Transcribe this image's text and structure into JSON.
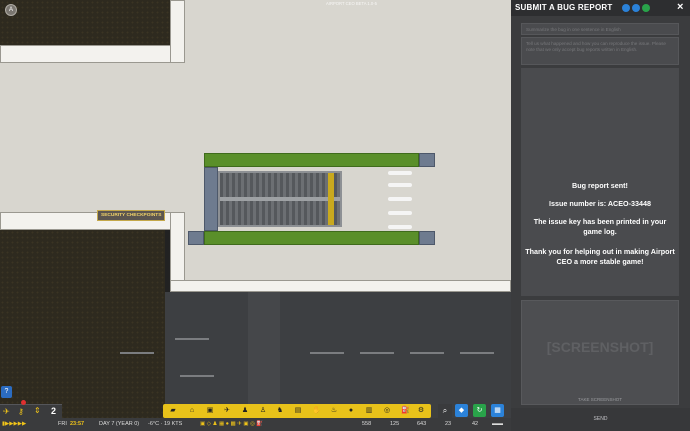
{
  "game": {
    "title": "Airport CEO",
    "build_version": "AIRPORT CEO BETA 1.0-5",
    "security_sign": "SECURITY CHECKPOINTS",
    "help_label": "?",
    "zoom_level": "2"
  },
  "bottom_bar": {
    "day_name": "FRI",
    "time": "23:57",
    "day_label": "DAY 7 (YEAR 0)",
    "weather": "-6°C · 19 KTS",
    "stat_1": "558",
    "stat_2": "125",
    "stat_3": "643",
    "stat_4": "23",
    "stat_5": "42"
  },
  "bug_report": {
    "title": "SUBMIT A BUG REPORT",
    "close_label": "×",
    "summary_placeholder": "Summarize the bug in one sentence in English",
    "description_placeholder": "Tell us what happened and how you can reproduce the issue. Please note that we only accept bug reports written in English.",
    "status_line_1": "Bug report sent!",
    "status_line_2": "Issue number is: ACEO-33448",
    "status_line_3": "The issue key has been printed in your game log.",
    "status_line_4": "Thank you for helping out in making Airport CEO a more stable game!",
    "screenshot_placeholder": "[SCREENSHOT]",
    "take_screenshot_label": "TAKE SCREENSHOT",
    "send_label": "SEND"
  },
  "colors": {
    "toolbar": "#e8c21a",
    "panel": "#3b3c3e",
    "grass": "#5a8f2a",
    "accent_blue": "#2b82d9",
    "accent_green": "#29a34a"
  }
}
